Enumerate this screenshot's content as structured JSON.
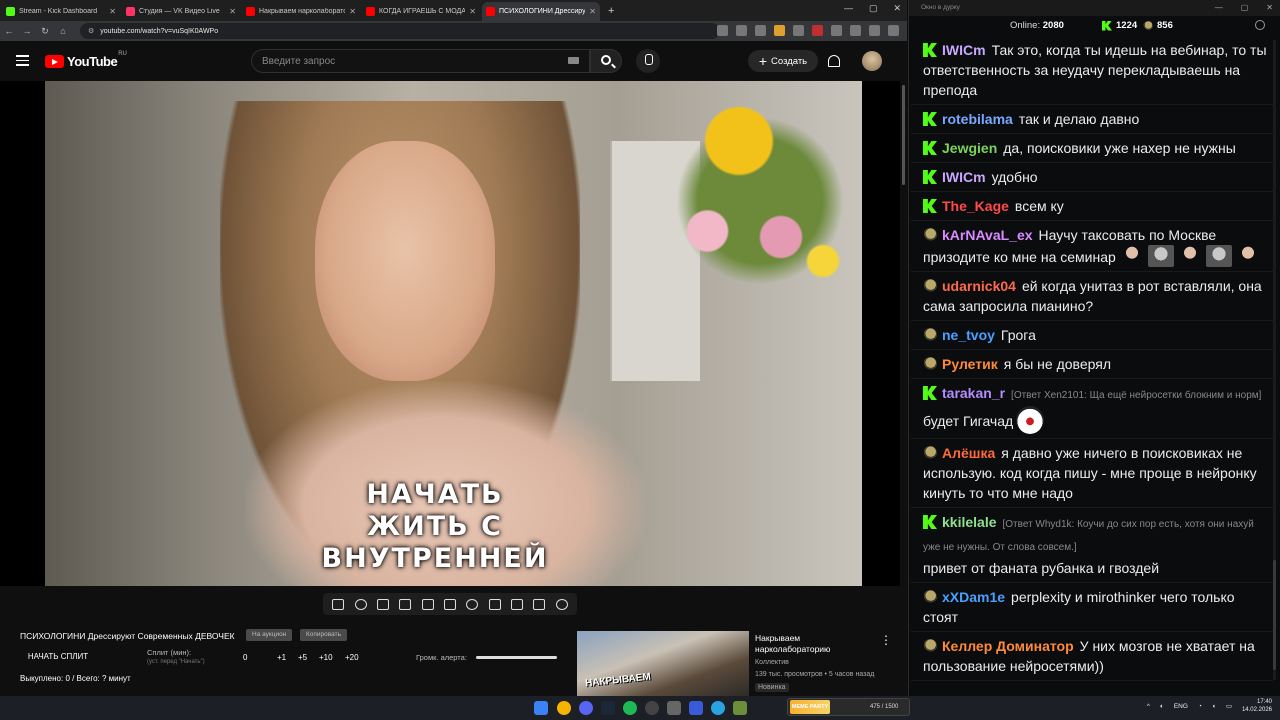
{
  "browser": {
    "tabs": [
      {
        "title": "Stream - Kick Dashboard",
        "favicon_color": "#53fc18",
        "active": false
      },
      {
        "title": "Студия — VK Видео Live",
        "favicon_color": "#ff3366",
        "active": false
      },
      {
        "title": "Накрываем нарколабораторию",
        "favicon_color": "#ff0000",
        "active": false
      },
      {
        "title": "КОГДА ИГРАЕШЬ С МОДАМИ",
        "favicon_color": "#ff0000",
        "active": false
      },
      {
        "title": "ПСИХОЛОГИНИ Дрессируют",
        "favicon_color": "#ff0000",
        "active": true
      }
    ],
    "new_tab": "+",
    "url": "youtube.com/watch?v=vuSqIK0AWPo"
  },
  "youtube": {
    "logo_word": "YouTube",
    "logo_region": "RU",
    "search_placeholder": "Введите запрос",
    "create_label": "Создать",
    "create_plus": "+"
  },
  "video": {
    "subtitle_lines": [
      "НАЧАТЬ",
      "ЖИТЬ С",
      "ВНУТРЕННЕЙ"
    ]
  },
  "panel": {
    "video_title": "ПСИХОЛОГИНИ Дрессируют Современных ДЕВОЧЕК",
    "auction_button": "На аукцион",
    "copy_button": "Копировать",
    "split_button": "НАЧАТЬ СПЛИТ",
    "split_label": "Сплит (мин):",
    "split_hint": "(уст. перед \"Начать\")",
    "split_value": "0",
    "increments": [
      "+1",
      "+5",
      "+10",
      "+20"
    ],
    "volume_label": "Громк. алерта:",
    "bought": "Выкуплено: 0 / Всего: ? минут"
  },
  "recommendation": {
    "thumb_text": "НАКРЫВАЕМ",
    "title": "Накрываем нарколабораторию",
    "channel": "Коллектив",
    "stats": "139 тыс. просмотров • 5 часов назад",
    "badge": "Новинка",
    "more": "⋮"
  },
  "chat": {
    "window_title": "Окно в дурку",
    "online_label": "Online:",
    "online_count": "2080",
    "kick_count": "1224",
    "vk_count": "856",
    "messages": [
      {
        "platform": "k",
        "user": "IWICm",
        "color": "#c9a7ff",
        "text": "Так это, когда ты идешь на вебинар, то ты ответственность за неудачу перекладываешь на препода"
      },
      {
        "platform": "k",
        "user": "rotebilama",
        "color": "#7aa7ff",
        "text": "так и делаю давно"
      },
      {
        "platform": "k",
        "user": "Jewgien",
        "color": "#7ad35a",
        "text": "да, поисковики уже нахер не нужны"
      },
      {
        "platform": "k",
        "user": "IWICm",
        "color": "#c9a7ff",
        "text": "удобно"
      },
      {
        "platform": "k",
        "user": "The_Kage",
        "color": "#ff4a4a",
        "text": "всем ку"
      },
      {
        "platform": "v",
        "user": "kArNAvaL_ex",
        "color": "#d98aff",
        "text": "Научу таксовать по Москве призодите ко мне на семинар"
      },
      {
        "platform": "v",
        "user": "udarnick04",
        "color": "#ff6a4a",
        "text": "ей когда унитаз в рот вставляли, она сама запросила пианино?"
      },
      {
        "platform": "v",
        "user": "ne_tvoy",
        "color": "#4aa0ff",
        "text": "Грога"
      },
      {
        "platform": "v",
        "user": "Рулетик",
        "color": "#ff8a3a",
        "text": "я бы не доверял"
      },
      {
        "platform": "k",
        "user": "tarakan_r",
        "color": "#b58cff",
        "reply": "[Ответ Xen2101: Ща ещё нейросетки блокним и норм]",
        "text": "будет Гигачад"
      },
      {
        "platform": "v",
        "user": "Алёшка",
        "color": "#ff6a3a",
        "text": "я давно уже ничего в поисковиках не использую. код когда пишу - мне проще в нейронку кинуть то что мне надо"
      },
      {
        "platform": "k",
        "user": "kkilelale",
        "color": "#8fe08f",
        "reply": "[Ответ Whyd1k: Коучи до сих пор есть, хотя они нахуй уже не нужны. От слова совсем.]",
        "text": "привет от фаната рубанка и гвоздей"
      },
      {
        "platform": "v",
        "user": "xXDam1e",
        "color": "#4aa0ff",
        "text": "perplexity и mirothinker чего только стоят"
      },
      {
        "platform": "v",
        "user": "Келлер Доминатор",
        "color": "#ff8a3a",
        "text": "У них мозгов не хватает на пользование нейросетями))"
      }
    ]
  },
  "taskbar": {
    "meme_logo": "MEME PARTY",
    "meme_count": "475 / 1500",
    "lang": "ENG",
    "time": "17:40",
    "date": "14.02.2026"
  }
}
